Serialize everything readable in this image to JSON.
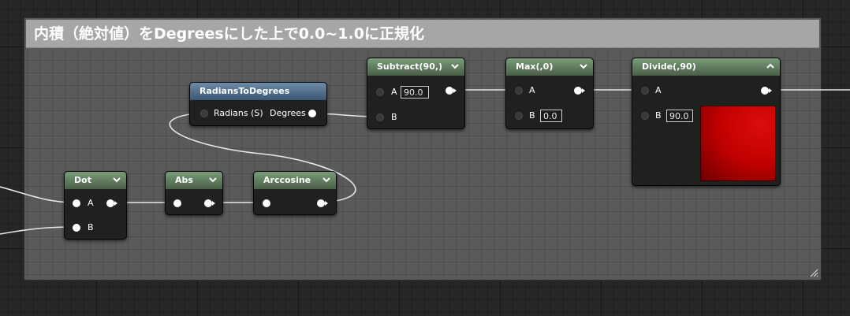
{
  "comment": {
    "title": "内積（絶対値）をDegreesにした上で0.0~1.0に正規化"
  },
  "nodes": {
    "radians_to_degrees": {
      "title": "RadiansToDegrees",
      "input_label": "Radians (S)",
      "output_label": "Degrees"
    },
    "subtract": {
      "title": "Subtract(90,)",
      "pin_a": "A",
      "pin_a_value": "90.0",
      "pin_b": "B"
    },
    "max": {
      "title": "Max(,0)",
      "pin_a": "A",
      "pin_b": "B",
      "pin_b_value": "0.0"
    },
    "divide": {
      "title": "Divide(,90)",
      "pin_a": "A",
      "pin_b": "B",
      "pin_b_value": "90.0",
      "preview_color": "#c00000"
    },
    "dot": {
      "title": "Dot",
      "pin_a": "A",
      "pin_b": "B"
    },
    "abs": {
      "title": "Abs"
    },
    "arccosine": {
      "title": "Arccosine"
    }
  },
  "icons": {
    "collapse": "chevron-down-icon",
    "expand": "chevron-up-icon",
    "resize": "resize-grip-icon"
  },
  "colors": {
    "function_header": "#5d7a5b",
    "conversion_header": "#4a6b88",
    "comment_title_bar": "#a6a6a6",
    "comment_body": "#5a5a5a",
    "wire": "#e8e8e8"
  }
}
